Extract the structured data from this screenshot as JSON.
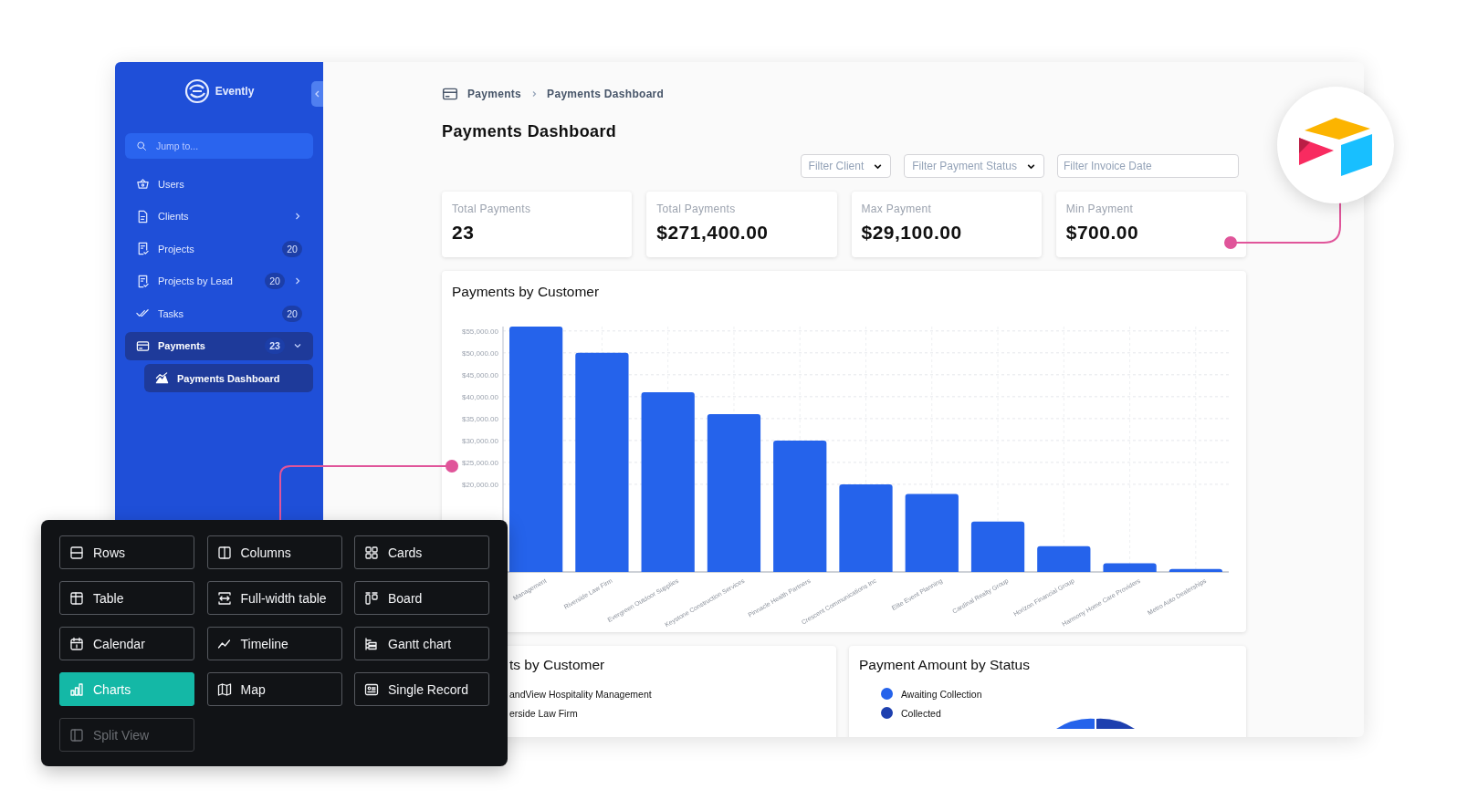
{
  "sidebar": {
    "brand": "Evently",
    "search": {
      "placeholder": "Jump to..."
    },
    "items": [
      {
        "label": "Users",
        "selected": false
      },
      {
        "label": "Clients",
        "selected": false,
        "expanded": false
      },
      {
        "label": "Projects",
        "selected": false,
        "count": "20"
      },
      {
        "label": "Projects by Lead",
        "selected": false,
        "count": "20",
        "expanded": false
      },
      {
        "label": "Tasks",
        "selected": false,
        "count": "20"
      },
      {
        "label": "Payments",
        "selected": true,
        "count": "23",
        "expanded": true,
        "children": [
          {
            "label": "Payments Dashboard",
            "selected": true
          }
        ]
      }
    ]
  },
  "breadcrumb": [
    "Payments",
    "Payments Dashboard"
  ],
  "page_title": "Payments Dashboard",
  "filters": [
    {
      "kind": "select",
      "placeholder": "Filter Client"
    },
    {
      "kind": "select",
      "placeholder": "Filter Payment Status"
    },
    {
      "kind": "date",
      "placeholder": "Filter Invoice Date"
    }
  ],
  "stats": [
    {
      "label": "Total Payments",
      "value": "23"
    },
    {
      "label": "Total Payments",
      "value": "$271,400.00"
    },
    {
      "label": "Max Payment",
      "value": "$29,100.00"
    },
    {
      "label": "Min Payment",
      "value": "$700.00"
    }
  ],
  "main_chart": {
    "title": "Payments by Customer",
    "chart_data": {
      "type": "bar",
      "grid": true,
      "categories": [
        "Management",
        "Riverside Law Firm",
        "Evergreen Outdoor Supplies",
        "Keystone Construction Services",
        "Pinnacle Health Partners",
        "Crescent Communications Inc",
        "Elite Event Planning",
        "Cardinal Realty Group",
        "Horizon Financial Group",
        "Harmony Home Care Providers",
        "Metro Auto Dealerships"
      ],
      "values": [
        56000,
        50000,
        41000,
        36000,
        30000,
        20000,
        17800,
        11500,
        5900,
        2000,
        700
      ],
      "ylim": [
        0,
        56000
      ],
      "yticks": [
        {
          "value": 20000,
          "label": "$20,000.00"
        },
        {
          "value": 25000,
          "label": "$25,000.00"
        },
        {
          "value": 30000,
          "label": "$30,000.00"
        },
        {
          "value": 35000,
          "label": "$35,000.00"
        },
        {
          "value": 40000,
          "label": "$40,000.00"
        },
        {
          "value": 45000,
          "label": "$45,000.00"
        },
        {
          "value": 50000,
          "label": "$50,000.00"
        },
        {
          "value": 55000,
          "label": "$55,000.00"
        }
      ]
    }
  },
  "lower_panels": [
    {
      "title": "ts by Customer",
      "legend": [
        {
          "label": "andView Hospitality Management"
        },
        {
          "label": "erside Law Firm"
        }
      ]
    },
    {
      "title": "Payment Amount by Status",
      "legend": [
        {
          "label": "Awaiting Collection",
          "color": "#2563eb"
        },
        {
          "label": "Collected",
          "color": "#1e40af"
        }
      ]
    }
  ],
  "view_picker": [
    {
      "label": "Rows",
      "selected": false,
      "disabled": false
    },
    {
      "label": "Columns",
      "selected": false,
      "disabled": false
    },
    {
      "label": "Cards",
      "selected": false,
      "disabled": false
    },
    {
      "label": "Table",
      "selected": false,
      "disabled": false
    },
    {
      "label": "Full-width table",
      "selected": false,
      "disabled": false
    },
    {
      "label": "Board",
      "selected": false,
      "disabled": false
    },
    {
      "label": "Calendar",
      "selected": false,
      "disabled": false
    },
    {
      "label": "Timeline",
      "selected": false,
      "disabled": false
    },
    {
      "label": "Gantt chart",
      "selected": false,
      "disabled": false
    },
    {
      "label": "Charts",
      "selected": true,
      "disabled": false
    },
    {
      "label": "Map",
      "selected": false,
      "disabled": false
    },
    {
      "label": "Single Record",
      "selected": false,
      "disabled": false
    },
    {
      "label": "Split View",
      "selected": false,
      "disabled": true
    }
  ]
}
